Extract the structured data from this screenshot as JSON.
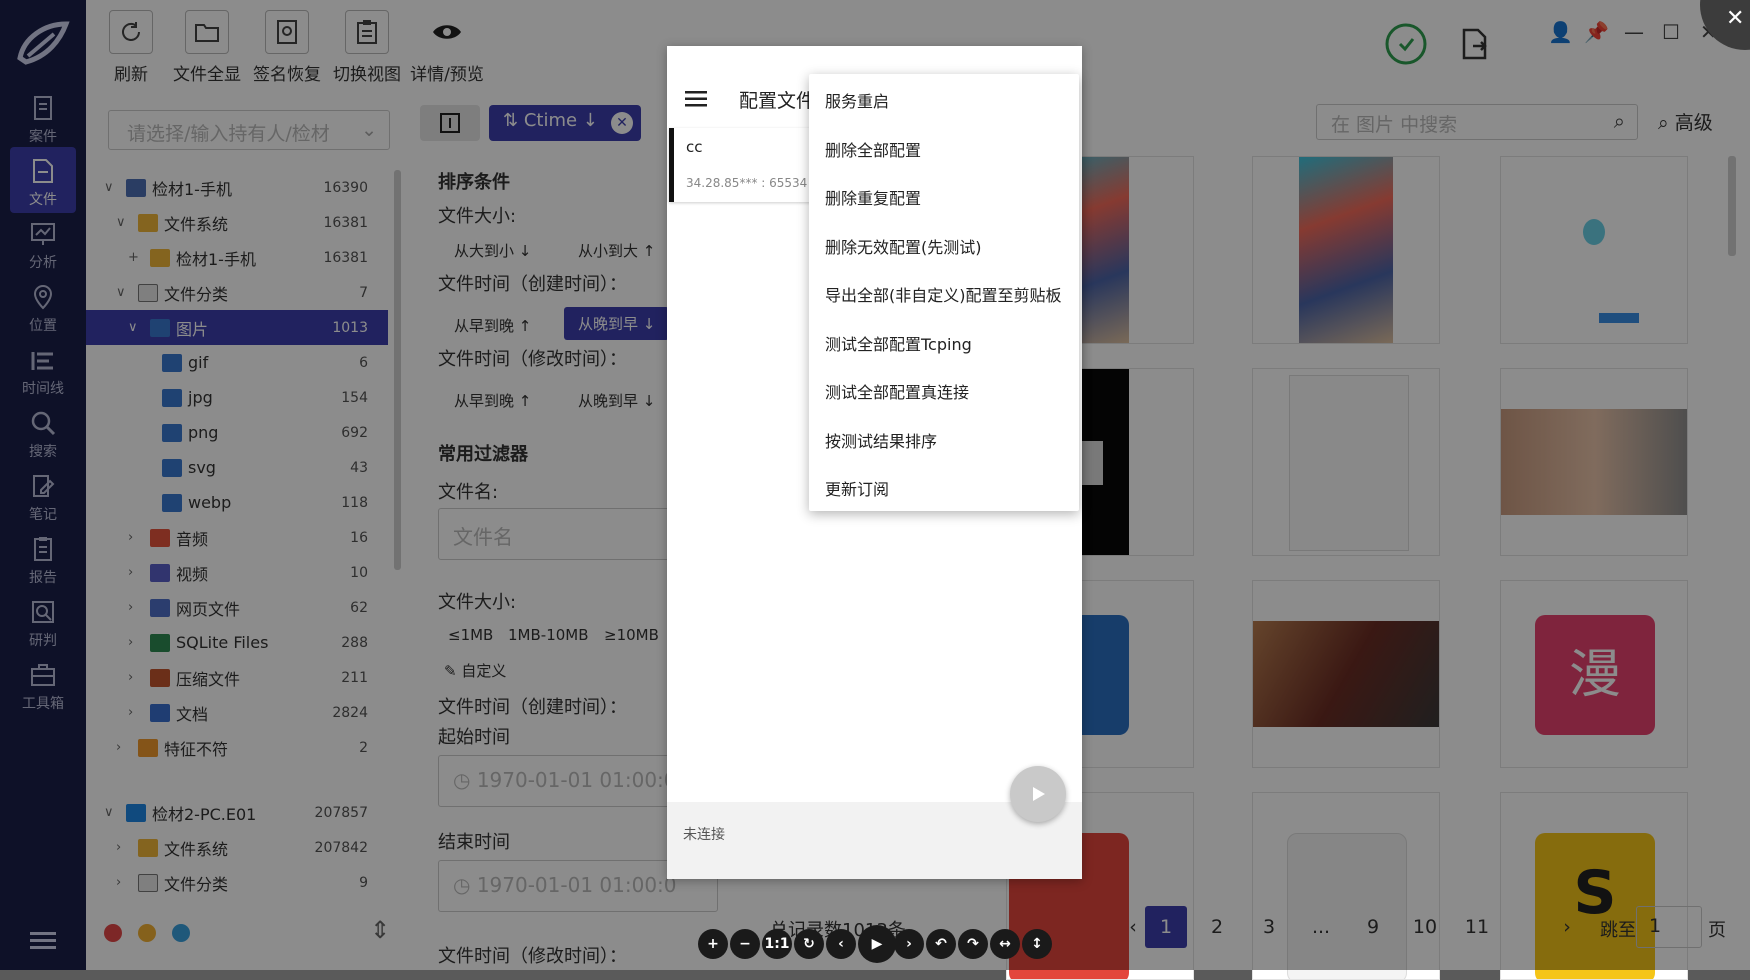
{
  "nav": {
    "items": [
      "案件",
      "文件",
      "分析",
      "位置",
      "时间线",
      "搜索",
      "笔记",
      "报告",
      "研判",
      "工具箱"
    ],
    "active_index": 1
  },
  "toolbar": {
    "refresh": "刷新",
    "show_all": "文件全显",
    "sig_restore": "签名恢复",
    "switch_view": "切换视图",
    "details": "详情/预览"
  },
  "owner_placeholder": "请选择/输入持有人/检材",
  "tree": [
    {
      "label": "检材1-手机",
      "count": "16390",
      "level": 0,
      "arrow": "v",
      "icon": "phone"
    },
    {
      "label": "文件系统",
      "count": "16381",
      "level": 1,
      "arrow": "v",
      "icon": "folder"
    },
    {
      "label": "检材1-手机",
      "count": "16381",
      "level": 2,
      "arrow": "+",
      "icon": "folder"
    },
    {
      "label": "文件分类",
      "count": "7",
      "level": 1,
      "arrow": "v",
      "icon": "doc"
    },
    {
      "label": "图片",
      "count": "1013",
      "level": 2,
      "arrow": "v",
      "icon": "image",
      "selected": true
    },
    {
      "label": "gif",
      "count": "6",
      "level": 3,
      "arrow": "",
      "icon": "image"
    },
    {
      "label": "jpg",
      "count": "154",
      "level": 3,
      "arrow": "",
      "icon": "image"
    },
    {
      "label": "png",
      "count": "692",
      "level": 3,
      "arrow": "",
      "icon": "image"
    },
    {
      "label": "svg",
      "count": "43",
      "level": 3,
      "arrow": "",
      "icon": "image"
    },
    {
      "label": "webp",
      "count": "118",
      "level": 3,
      "arrow": "",
      "icon": "image"
    },
    {
      "label": "音频",
      "count": "16",
      "level": 2,
      "arrow": ">",
      "icon": "audio"
    },
    {
      "label": "视频",
      "count": "10",
      "level": 2,
      "arrow": ">",
      "icon": "video"
    },
    {
      "label": "网页文件",
      "count": "62",
      "level": 2,
      "arrow": ">",
      "icon": "web"
    },
    {
      "label": "SQLite Files",
      "count": "288",
      "level": 2,
      "arrow": ">",
      "icon": "db"
    },
    {
      "label": "压缩文件",
      "count": "211",
      "level": 2,
      "arrow": ">",
      "icon": "zip"
    },
    {
      "label": "文档",
      "count": "2824",
      "level": 2,
      "arrow": ">",
      "icon": "docs"
    },
    {
      "label": "特征不符",
      "count": "2",
      "level": 1,
      "arrow": ">",
      "icon": "warn"
    },
    {
      "label": "检材2-PC.E01",
      "count": "207857",
      "level": 0,
      "arrow": "v",
      "icon": "win",
      "gap": true
    },
    {
      "label": "文件系统",
      "count": "207842",
      "level": 1,
      "arrow": ">",
      "icon": "folder"
    },
    {
      "label": "文件分类",
      "count": "9",
      "level": 1,
      "arrow": ">",
      "icon": "doc"
    }
  ],
  "filter": {
    "sort_chip": "Ctime",
    "sort_title": "排序条件",
    "size_label": "文件大小:",
    "size_desc": "从大到小",
    "size_asc": "从小到大",
    "ctime_label": "文件时间（创建时间）：",
    "mtime_label": "文件时间（修改时间）：",
    "early_late": "从早到晚",
    "late_early": "从晚到早",
    "common": "常用过滤器",
    "filename_label": "文件名:",
    "filename_placeholder": "文件名",
    "size_label2": "文件大小:",
    "size_opts": [
      "≤1MB",
      "1MB-10MB",
      "≥10MB"
    ],
    "custom": "自定义",
    "ctime_label2": "文件时间（创建时间）：",
    "start_time": "起始时间",
    "start_placeholder": "1970-01-01 01:00:0",
    "end_time": "结束时间",
    "end_placeholder": "1970-01-01 01:00:0",
    "mtime_label2": "文件时间（修改时间）："
  },
  "search": {
    "placeholder": "在 图片 中搜索",
    "advanced": "高级"
  },
  "pager": {
    "total": "总记录数1013条",
    "pages": [
      "1",
      "2",
      "3",
      "...",
      "9",
      "10",
      "11"
    ],
    "current": "1",
    "goto": "跳至",
    "goto_value": "1",
    "page_unit": "页"
  },
  "thumbs": {
    "manga_char": "漫",
    "s_char": "S"
  },
  "dialog": {
    "title": "配置文件",
    "server_name": "cc",
    "server_addr": "34.28.85*** : 65534",
    "status": "未连接"
  },
  "menu": [
    "服务重启",
    "删除全部配置",
    "删除重复配置",
    "删除无效配置(先测试)",
    "导出全部(非自定义)配置至剪贴板",
    "测试全部配置Tcping",
    "测试全部配置真连接",
    "按测试结果排序",
    "更新订阅"
  ],
  "viewer_tools": [
    "+",
    "−",
    "1:1",
    "↻",
    "‹",
    "▶",
    "›",
    "↶",
    "↷",
    "↔",
    "↕"
  ],
  "colors": {
    "accent": "#3d3fae",
    "rail": "#1b1f4a",
    "status_dots": [
      "#e34848",
      "#f2b134",
      "#3aa0de"
    ]
  }
}
